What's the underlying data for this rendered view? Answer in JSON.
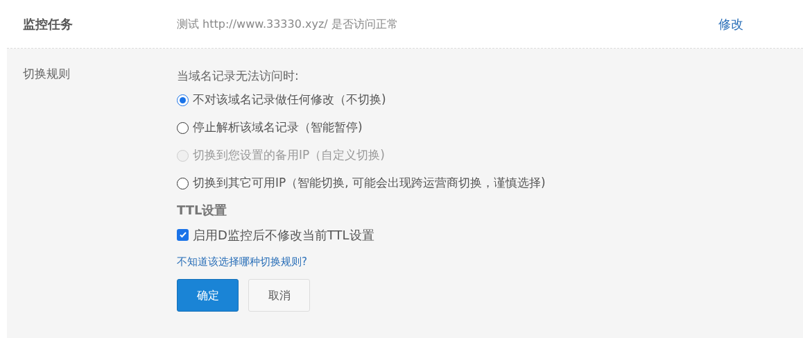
{
  "task": {
    "label": "监控任务",
    "value": "测试 http://www.33330.xyz/ 是否访问正常",
    "edit_link": "修改"
  },
  "rule": {
    "label": "切换规则",
    "prompt": "当域名记录无法访问时:",
    "options": [
      {
        "label": "不对该域名记录做任何修改（不切换)",
        "selected": true,
        "disabled": false
      },
      {
        "label": "停止解析该域名记录（智能暂停)",
        "selected": false,
        "disabled": false
      },
      {
        "label": "切换到您设置的备用IP（自定义切换)",
        "selected": false,
        "disabled": true
      },
      {
        "label": "切换到其它可用IP（智能切换, 可能会出现跨运营商切换，谨慎选择)",
        "selected": false,
        "disabled": false
      }
    ],
    "ttl_heading": "TTL设置",
    "ttl_checkbox": {
      "label": "启用D监控后不修改当前TTL设置",
      "checked": true
    },
    "help_link": "不知道该选择哪种切换规则?",
    "buttons": [
      {
        "label": "确定",
        "kind": "primary"
      },
      {
        "label": "取消",
        "kind": "secondary"
      }
    ]
  }
}
